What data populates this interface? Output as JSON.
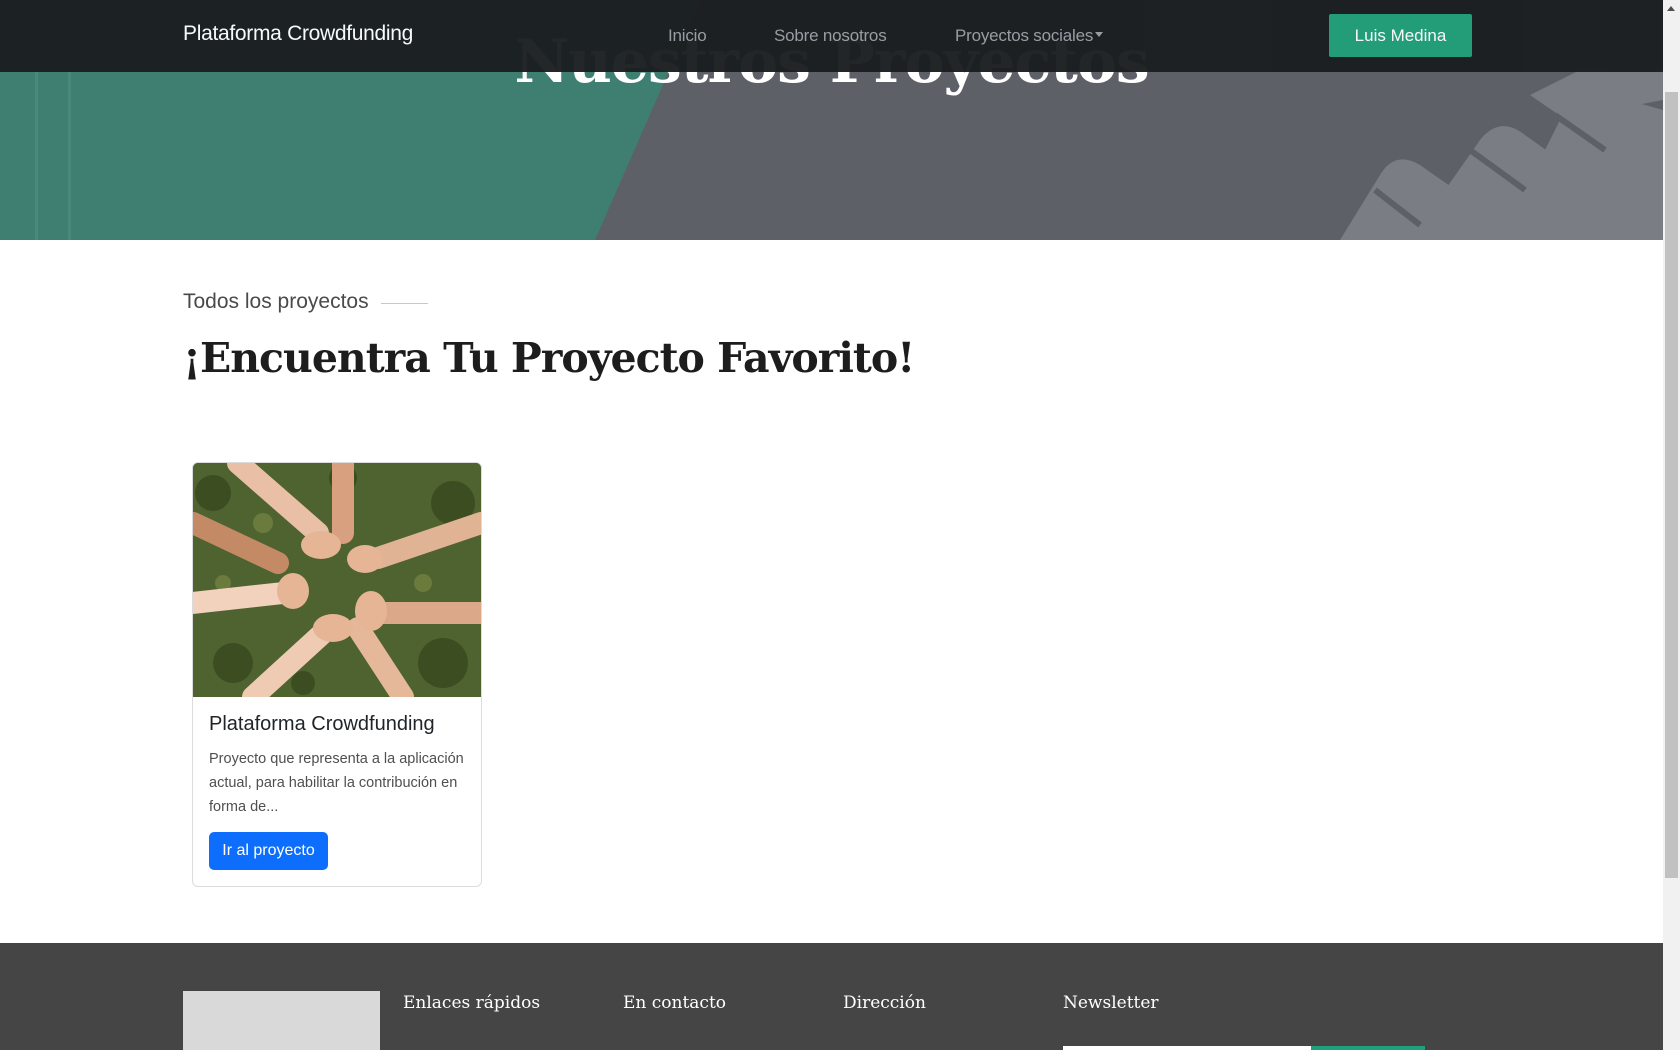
{
  "navbar": {
    "brand": "Plataforma Crowdfunding",
    "links": [
      "Inicio",
      "Sobre nosotros",
      "Proyectos sociales"
    ],
    "user_button": "Luis Medina"
  },
  "hero": {
    "title": "Nuestros Proyectos"
  },
  "section": {
    "eyebrow": "Todos los proyectos",
    "title": "¡Encuentra Tu Proyecto Favorito!"
  },
  "projects": [
    {
      "title": "Plataforma Crowdfunding",
      "description": "Proyecto que representa a la aplicación actual, para habilitar la contribución en forma de...",
      "button": "Ir al proyecto",
      "image_icon": "hands-circle-photo"
    }
  ],
  "footer": {
    "headings": [
      "Enlaces rápidos",
      "En contacto",
      "Dirección",
      "Newsletter"
    ]
  },
  "colors": {
    "accent": "#20a079",
    "primary_button": "#0d6efd",
    "navbar": "#1b1e21",
    "footer": "#454545"
  }
}
